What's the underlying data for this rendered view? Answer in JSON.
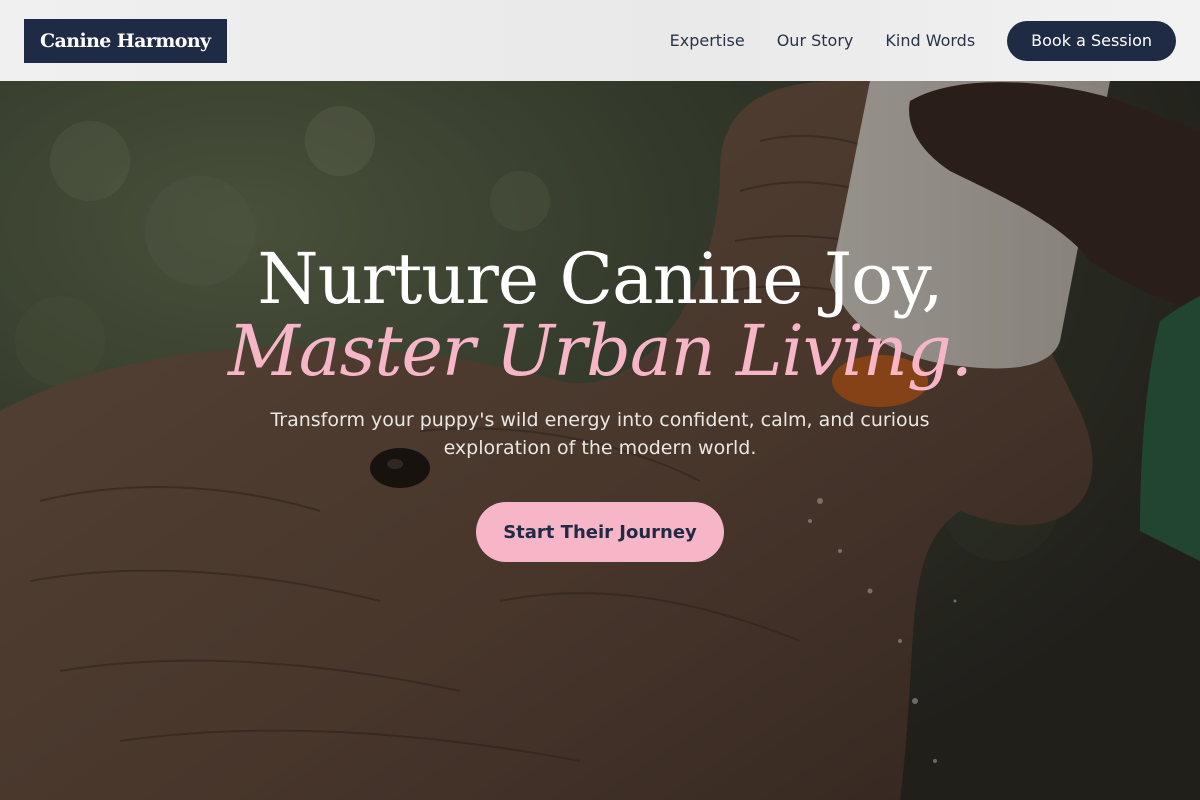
{
  "brand": {
    "name": "Canine Harmony"
  },
  "nav": {
    "links": [
      "Expertise",
      "Our Story",
      "Kind Words"
    ],
    "cta_label": "Book a Session"
  },
  "hero": {
    "headline_line1": "Nurture Canine Joy,",
    "headline_line2": "Master Urban Living.",
    "subtext": "Transform your puppy's wild energy into confident, calm, and curious exploration of the modern world.",
    "cta_label": "Start Their Journey",
    "background_image": "baby-elephant-drinking-from-milk-bottle"
  },
  "colors": {
    "navy": "#1f2a44",
    "accent_pink": "#f7b6c8",
    "header_bg": "#efefef"
  }
}
